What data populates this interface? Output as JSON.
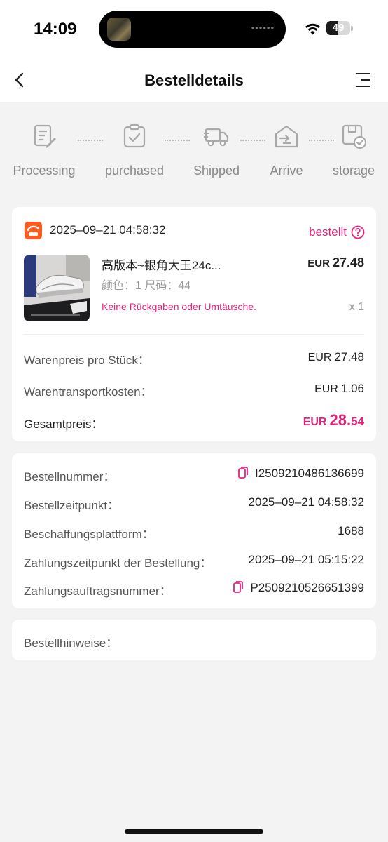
{
  "status_bar": {
    "time": "14:09",
    "battery": "49",
    "battery_level": 0.49,
    "island_dots": "••••••"
  },
  "nav": {
    "title": "Bestelldetails",
    "back_icon": "chevron-left-icon",
    "menu_icon": "menu-icon"
  },
  "steps": [
    {
      "label": "Processing",
      "icon": "document-edit-icon"
    },
    {
      "label": "purchased",
      "icon": "clipboard-check-icon"
    },
    {
      "label": "Shipped",
      "icon": "truck-icon"
    },
    {
      "label": "Arrive",
      "icon": "warehouse-icon"
    },
    {
      "label": "storage",
      "icon": "box-check-icon"
    }
  ],
  "order": {
    "date": "2025–09–21 04:58:32",
    "status": "bestellt",
    "product": {
      "title": "高版本~银角大王24c...",
      "variant": "颜色：1 尺码：44",
      "note": "Keine Rückgaben oder Umtäusche.",
      "currency": "EUR",
      "price": "27.48",
      "qty": "x 1"
    },
    "summary": {
      "unit_price_label": "Warenpreis pro Stück：",
      "unit_price_currency": "EUR",
      "unit_price": "27.48",
      "shipping_label": "Warentransportkosten：",
      "shipping_currency": "EUR",
      "shipping": "1.06",
      "total_label": "Gesamtpreis：",
      "total_currency": "EUR",
      "total_int": "28.",
      "total_dec": "54"
    }
  },
  "info": {
    "order_number_label": "Bestellnummer：",
    "order_number": "I2509210486136699",
    "order_time_label": "Bestellzeitpunkt：",
    "order_time": "2025–09–21 04:58:32",
    "platform_label": "Beschaffungsplattform：",
    "platform": "1688",
    "payment_time_label": "Zahlungszeitpunkt der Bestellung：",
    "payment_time": "2025–09–21 05:15:22",
    "payment_number_label": "Zahlungsauftragsnummer：",
    "payment_number": "P2509210526651399"
  },
  "notes": {
    "label": "Bestellhinweise："
  },
  "colors": {
    "accent": "#e0257d",
    "shop_logo": "#ff5a1f",
    "background": "#f3f3f4"
  }
}
